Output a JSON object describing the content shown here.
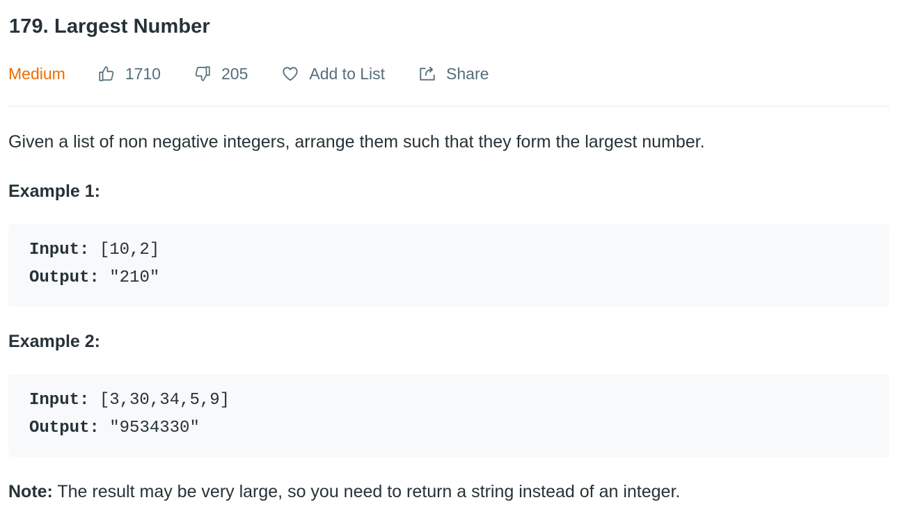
{
  "problem": {
    "title": "179. Largest Number",
    "difficulty": "Medium",
    "likes": "1710",
    "dislikes": "205",
    "add_to_list": "Add to List",
    "share": "Share",
    "difficulty_color": "#ef6c00",
    "icons": [
      "thumbs-up-icon",
      "thumbs-down-icon",
      "heart-icon",
      "share-icon"
    ]
  },
  "description": "Given a list of non negative integers, arrange them such that they form the largest number.",
  "examples": [
    {
      "title": "Example 1:",
      "input_label": "Input:",
      "input_value": " [10,2]",
      "output_label": "Output:",
      "output_value": " \"210\""
    },
    {
      "title": "Example 2:",
      "input_label": "Input:",
      "input_value": " [3,30,34,5,9]",
      "output_label": "Output:",
      "output_value": " \"9534330\""
    }
  ],
  "note": {
    "label": "Note:",
    "text": " The result may be very large, so you need to return a string instead of an integer."
  }
}
